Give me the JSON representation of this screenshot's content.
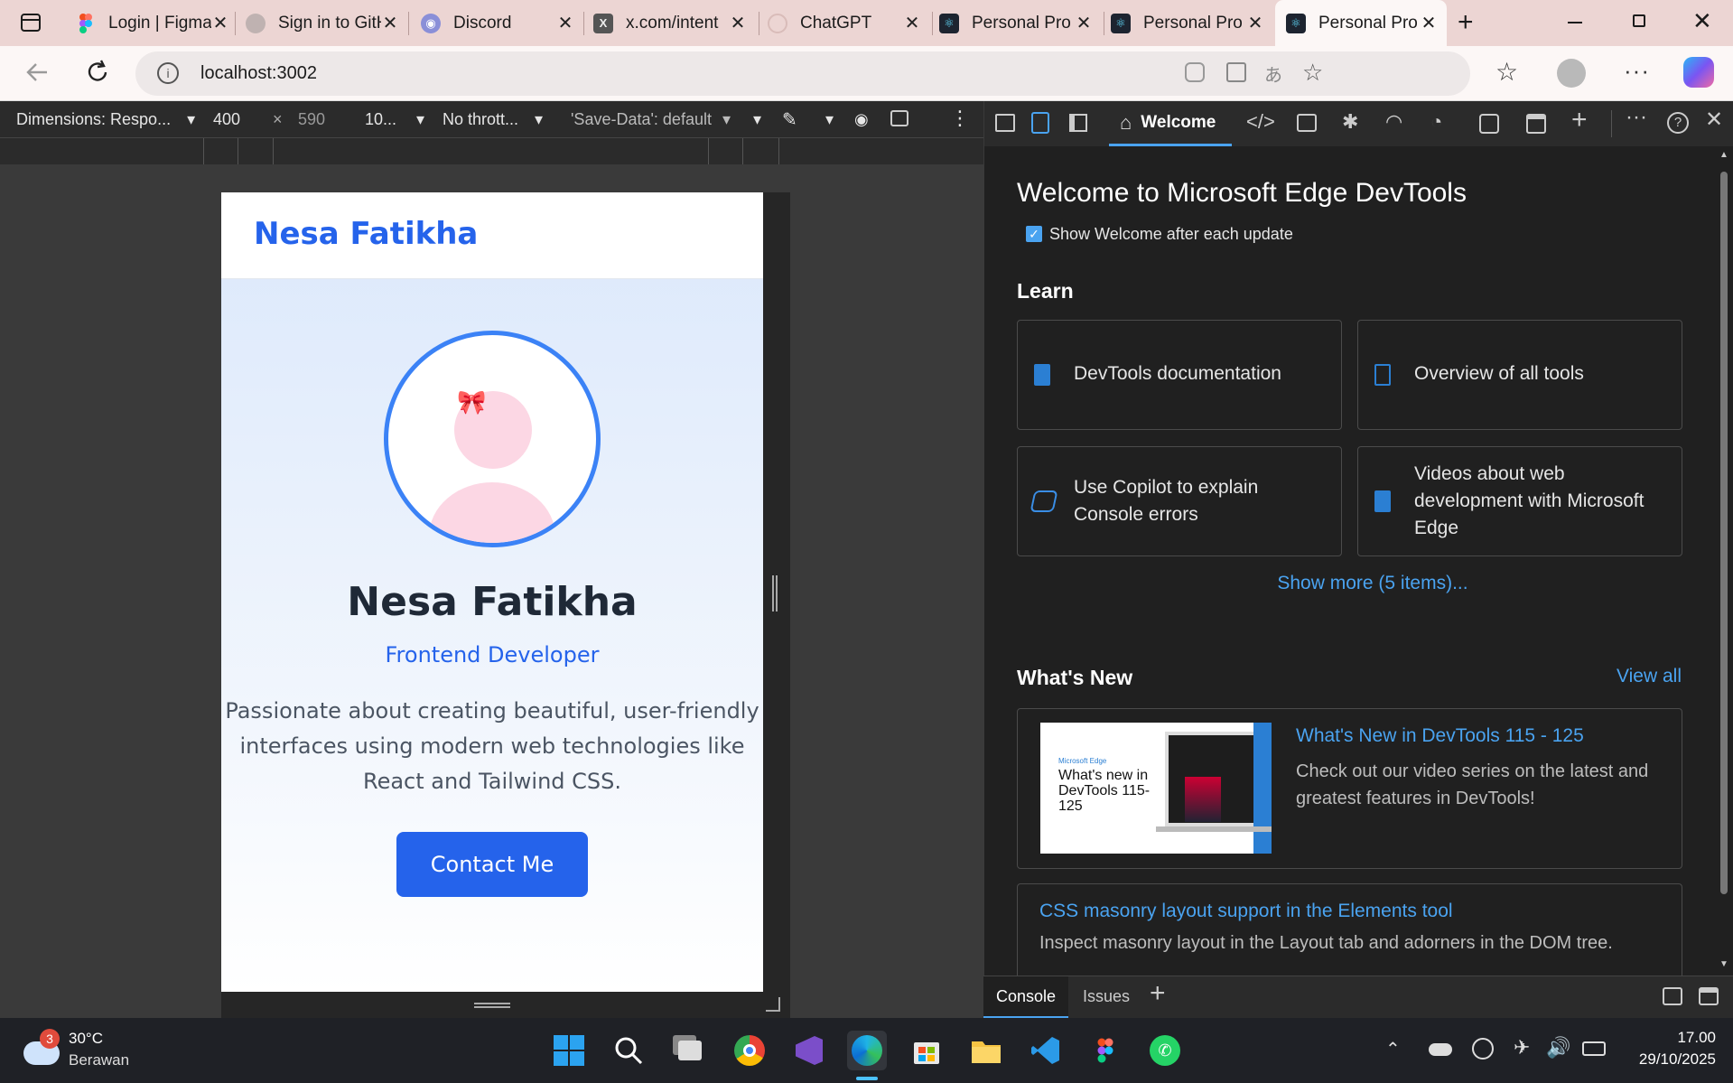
{
  "tabs": [
    {
      "title": "Login | Figma",
      "icon": "figma-icon"
    },
    {
      "title": "Sign in to GitHub",
      "icon": "github-icon"
    },
    {
      "title": "Discord",
      "icon": "discord-icon"
    },
    {
      "title": "x.com/intent",
      "icon": "x-icon"
    },
    {
      "title": "ChatGPT",
      "icon": "chatgpt-icon"
    },
    {
      "title": "Personal Pro",
      "icon": "react-icon"
    },
    {
      "title": "Personal Pro",
      "icon": "react-icon"
    },
    {
      "title": "Personal Pro",
      "icon": "react-icon"
    }
  ],
  "address": {
    "url": "localhost:3002"
  },
  "device_toolbar": {
    "dimensions": "Dimensions: Respo...",
    "width": "400",
    "times": "×",
    "height": "590",
    "zoom": "10...",
    "throttle": "No thrott...",
    "save_data": "'Save-Data': default"
  },
  "site": {
    "brand": "Nesa Fatikha",
    "name": "Nesa Fatikha",
    "role": "Frontend Developer",
    "bio": "Passionate about creating beautiful, user-friendly interfaces using modern web technologies like React and Tailwind CSS.",
    "cta": "Contact Me"
  },
  "devtools": {
    "tab_welcome": "Welcome",
    "heading": "Welcome to Microsoft Edge DevTools",
    "show_welcome": "Show Welcome after each update",
    "learn": "Learn",
    "cards": [
      "DevTools documentation",
      "Overview of all tools",
      "Use Copilot to explain Console errors",
      "Videos about web development with Microsoft Edge"
    ],
    "show_more": "Show more (5 items)...",
    "whats_new": "What's New",
    "view_all": "View all",
    "news": [
      {
        "title": "What's New in DevTools 115 - 125",
        "desc": "Check out our video series on the latest and greatest features in DevTools!",
        "thumb_brand": "Microsoft Edge",
        "thumb_text": "What's new in DevTools 115-125"
      },
      {
        "title": "CSS masonry layout support in the Elements tool",
        "desc": "Inspect masonry layout in the Layout tab and adorners in the DOM tree."
      }
    ],
    "drawer_console": "Console",
    "drawer_issues": "Issues"
  },
  "taskbar": {
    "temp": "30°C",
    "weather": "Berawan",
    "weather_badge": "3",
    "time": "17.00",
    "date": "29/10/2025"
  },
  "colors": {
    "accent": "#2563eb",
    "tab_bg": "#ecd5d3",
    "devtools_link": "#4aa3f0"
  }
}
